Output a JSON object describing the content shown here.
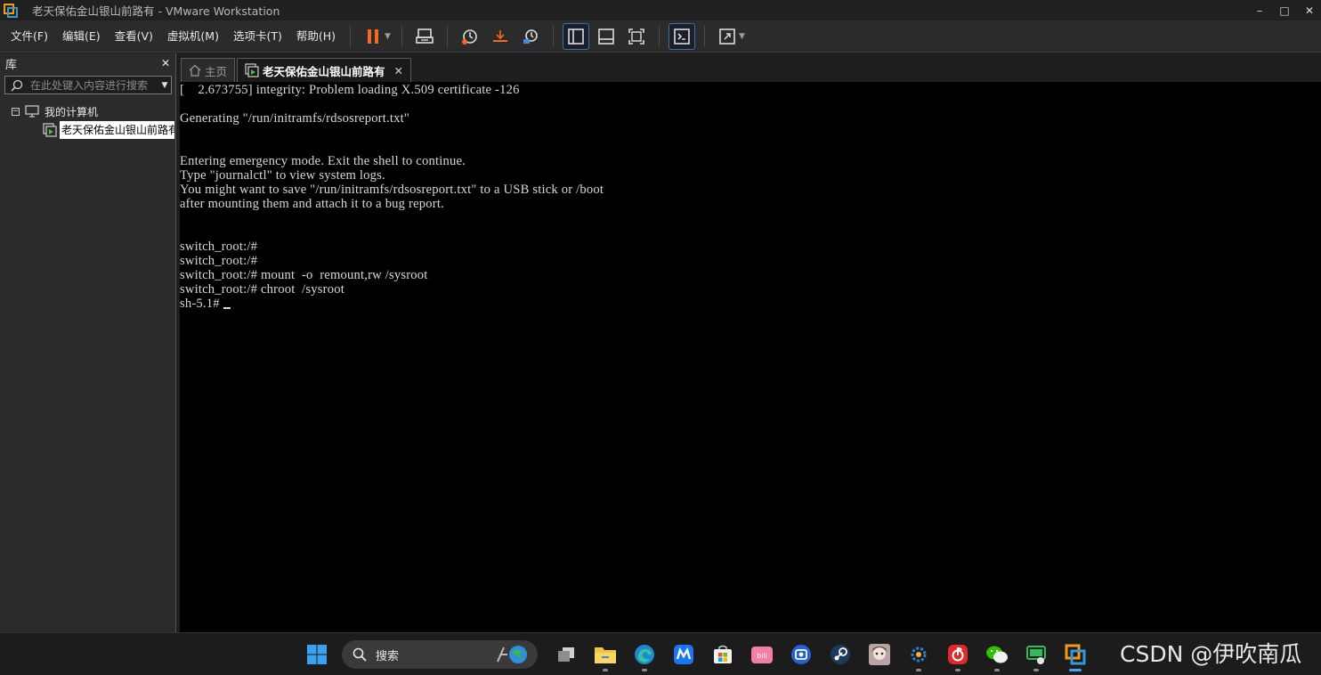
{
  "window": {
    "title": "老天保佑金山银山前路有 - VMware Workstation",
    "controls": {
      "minimize": "–",
      "maximize": "□",
      "close": "✕"
    }
  },
  "menu": {
    "items": [
      "文件(F)",
      "编辑(E)",
      "查看(V)",
      "虚拟机(M)",
      "选项卡(T)",
      "帮助(H)"
    ]
  },
  "toolbar": {
    "buttons": [
      "pause-icon",
      "send-ctrl-alt-del-icon",
      "snapshot-icon",
      "revert-snapshot-icon",
      "snapshot-manager-icon",
      "show-library-icon",
      "thumbnail-bar-icon",
      "full-screen-icon",
      "console-view-icon",
      "stretch-guest-icon"
    ],
    "active": [
      "show-library-icon",
      "console-view-icon"
    ],
    "pause_color": "#f26b1d"
  },
  "library": {
    "title": "库",
    "close": "✕",
    "search_placeholder": "在此处键入内容进行搜索",
    "root_expander": "−",
    "root_label": "我的计算机",
    "vm_label": "老天保佑金山银山前路有"
  },
  "tabs": [
    {
      "label": "主页",
      "icon": "home-icon",
      "active": false
    },
    {
      "label": "老天保佑金山银山前路有",
      "icon": "vm-running-icon",
      "active": true,
      "close": "✕"
    }
  ],
  "console": {
    "lines": [
      "[    2.673755] integrity: Problem loading X.509 certificate -126",
      "",
      "Generating \"/run/initramfs/rdsosreport.txt\"",
      "",
      "",
      "Entering emergency mode. Exit the shell to continue.",
      "Type \"journalctl\" to view system logs.",
      "You might want to save \"/run/initramfs/rdsosreport.txt\" to a USB stick or /boot",
      "after mounting them and attach it to a bug report.",
      "",
      "",
      "switch_root:/#",
      "switch_root:/#",
      "switch_root:/# mount  -o  remount,rw /sysroot",
      "switch_root:/# chroot  /sysroot"
    ],
    "prompt": "sh-5.1# "
  },
  "taskbar": {
    "search_label": "搜索",
    "apps": [
      "start-icon",
      "search-box",
      "task-view-icon",
      "file-explorer-icon",
      "edge-icon",
      "app-m-icon",
      "store-icon",
      "bilibili-icon",
      "app-blue-icon",
      "steam-icon",
      "anime-avatar-icon",
      "settings-tool-icon",
      "netease-music-icon",
      "wechat-icon",
      "remote-desktop-icon",
      "vmware-icon"
    ],
    "watermark": "CSDN @伊吹南瓜"
  }
}
